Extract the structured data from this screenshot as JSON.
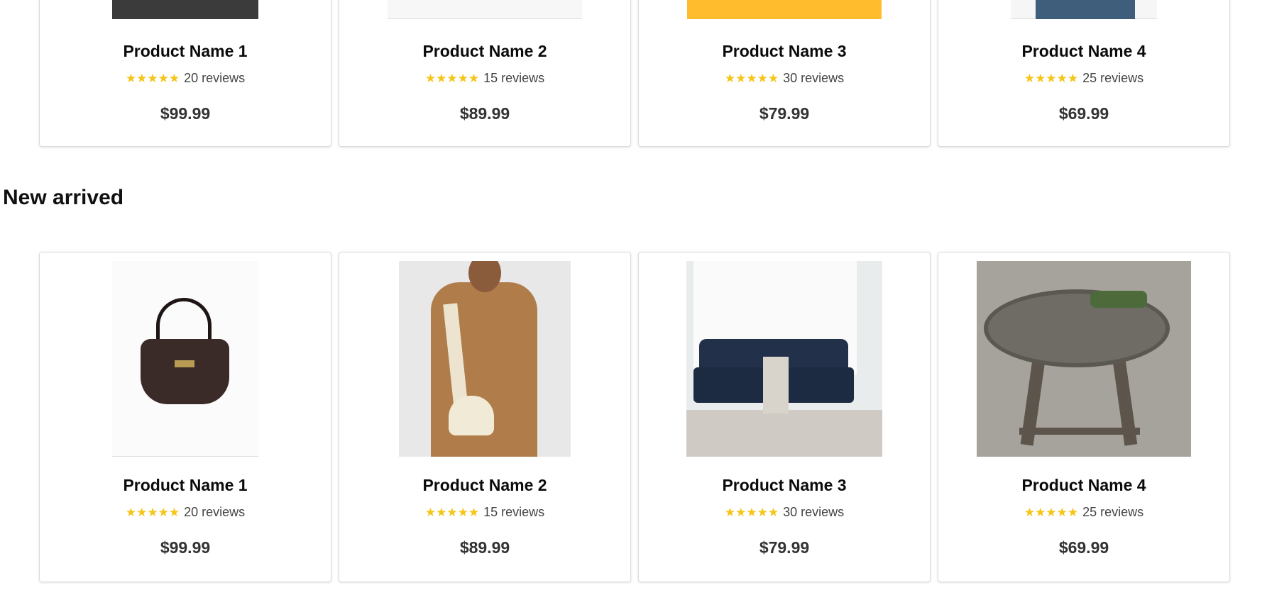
{
  "sections": {
    "new_arrived_heading": "New arrived"
  },
  "top_products": [
    {
      "name": "Product Name 1",
      "stars": "★★★★★",
      "reviews": "20 reviews",
      "price": "$99.99",
      "image_icon": "jeans-image"
    },
    {
      "name": "Product Name 2",
      "stars": "★★★★★",
      "reviews": "15 reviews",
      "price": "$89.99",
      "image_icon": "shirt-image"
    },
    {
      "name": "Product Name 3",
      "stars": "★★★★★",
      "reviews": "30 reviews",
      "price": "$79.99",
      "image_icon": "yellow-product-image"
    },
    {
      "name": "Product Name 4",
      "stars": "★★★★★",
      "reviews": "25 reviews",
      "price": "$69.99",
      "image_icon": "denim-shirt-image"
    }
  ],
  "new_products": [
    {
      "name": "Product Name 1",
      "stars": "★★★★★",
      "reviews": "20 reviews",
      "price": "$99.99",
      "image_icon": "handbag-image"
    },
    {
      "name": "Product Name 2",
      "stars": "★★★★★",
      "reviews": "15 reviews",
      "price": "$89.99",
      "image_icon": "crossbody-bag-model-image"
    },
    {
      "name": "Product Name 3",
      "stars": "★★★★★",
      "reviews": "30 reviews",
      "price": "$79.99",
      "image_icon": "sofa-image"
    },
    {
      "name": "Product Name 4",
      "stars": "★★★★★",
      "reviews": "25 reviews",
      "price": "$69.99",
      "image_icon": "coffee-table-image"
    }
  ],
  "colors": {
    "star": "#f5c518",
    "card_border": "#dcdcdc"
  }
}
